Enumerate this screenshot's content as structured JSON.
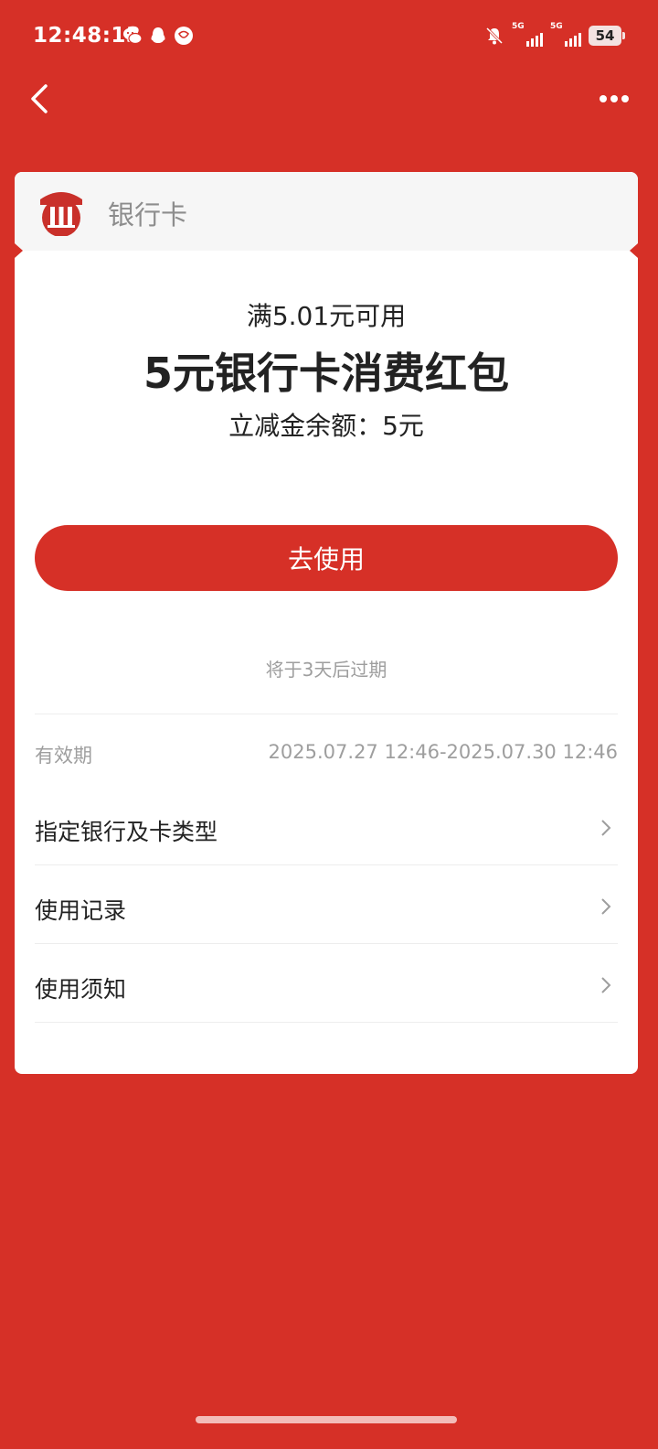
{
  "status_bar": {
    "time": "12:48:13",
    "network_1": "5G",
    "network_2": "5G",
    "battery": "54"
  },
  "nav": {
    "back_icon": "chevron-left-icon",
    "more_icon": "more-dots-icon"
  },
  "card": {
    "type_label": "银行卡",
    "logo_icon": "bank-icon",
    "condition": "满5.01元可用",
    "title": "5元银行卡消费红包",
    "balance": "立减金余额：5元",
    "use_button": "去使用",
    "expire_note": "将于3天后过期",
    "validity_label": "有效期",
    "validity_value": "2025.07.27 12:46-2025.07.30 12:46",
    "menu": [
      {
        "label": "指定银行及卡类型"
      },
      {
        "label": "使用记录"
      },
      {
        "label": "使用须知"
      }
    ]
  },
  "colors": {
    "brand_red": "#d63027",
    "text_dark": "#222222",
    "text_gray": "#9e9e9e"
  }
}
